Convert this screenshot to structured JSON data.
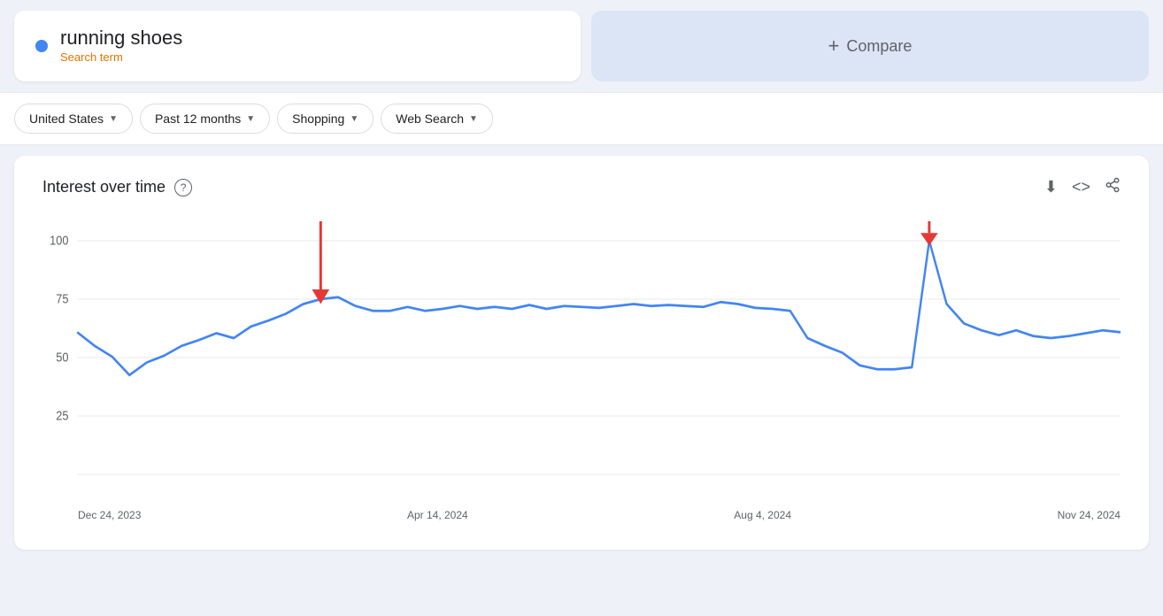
{
  "search": {
    "term": "running shoes",
    "type": "Search term"
  },
  "compare": {
    "label": "Compare",
    "plus": "+"
  },
  "filters": {
    "region": "United States",
    "period": "Past 12 months",
    "category": "Shopping",
    "type": "Web Search"
  },
  "chart": {
    "title": "Interest over time",
    "help_label": "?",
    "y_labels": [
      "100",
      "75",
      "50",
      "25"
    ],
    "x_labels": [
      "Dec 24, 2023",
      "Apr 14, 2024",
      "Aug 4, 2024",
      "Nov 24, 2024"
    ],
    "download_icon": "⬇",
    "embed_icon": "<>",
    "share_icon": "⋮"
  }
}
